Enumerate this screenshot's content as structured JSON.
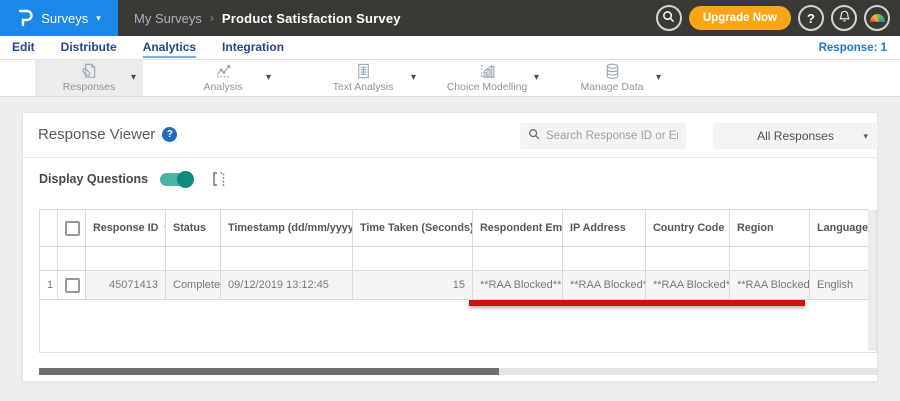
{
  "topnav": {
    "brand": "P",
    "app_menu_label": "Surveys",
    "breadcrumb": {
      "parent": "My Surveys",
      "separator": "›",
      "current": "Product Satisfaction Survey"
    },
    "upgrade_label": "Upgrade Now",
    "help_label": "?"
  },
  "tabs": {
    "items": [
      {
        "label": "Edit"
      },
      {
        "label": "Distribute"
      },
      {
        "label": "Analytics"
      },
      {
        "label": "Integration"
      }
    ],
    "active": "Analytics",
    "response_count_label": "Response: 1"
  },
  "toolbar": {
    "items": [
      {
        "label": "Responses",
        "icon": "responses-icon",
        "selected": true
      },
      {
        "label": "Analysis",
        "icon": "analysis-icon",
        "selected": false
      },
      {
        "label": "Text Analysis",
        "icon": "text-analysis-icon",
        "selected": false
      },
      {
        "label": "Choice Modelling",
        "icon": "choice-modelling-icon",
        "selected": false
      },
      {
        "label": "Manage Data",
        "icon": "manage-data-icon",
        "selected": false
      }
    ]
  },
  "viewer": {
    "title": "Response Viewer",
    "help_label": "?",
    "search_placeholder": "Search Response ID or Email",
    "filter_value": "All Responses",
    "display_questions_label": "Display Questions",
    "display_questions_on": true
  },
  "table": {
    "columns": [
      {
        "label": "Response ID",
        "sort": "desc"
      },
      {
        "label": "Status",
        "sort": "none"
      },
      {
        "label": "Timestamp (dd/mm/yyyy)",
        "sort": "both"
      },
      {
        "label": "Time Taken (Seconds)",
        "sort": "both"
      },
      {
        "label": "Respondent Email",
        "sort": "none"
      },
      {
        "label": "IP Address",
        "sort": "none"
      },
      {
        "label": "Country Code",
        "sort": "none"
      },
      {
        "label": "Region",
        "sort": "none"
      },
      {
        "label": "Language",
        "sort": "none"
      }
    ],
    "rows": [
      {
        "index": "1",
        "response_id": "45071413",
        "status": "Completed",
        "timestamp": "09/12/2019 13:12:45",
        "time_taken": "15",
        "respondent_email": "**RAA Blocked**",
        "ip_address": "**RAA Blocked**",
        "country_code": "**RAA Blocked**",
        "region": "**RAA Blocked**",
        "language": "English"
      }
    ]
  },
  "glyphs": {
    "caret_down": "▾",
    "sort_both": "⇅",
    "sort_desc": "▼"
  },
  "colors": {
    "accent_blue": "#1b87e6",
    "topbar_dark": "#3a3935",
    "upgrade_orange": "#f9a51a",
    "toggle_teal": "#0d8b7f",
    "annotation_red": "#ce1212"
  }
}
